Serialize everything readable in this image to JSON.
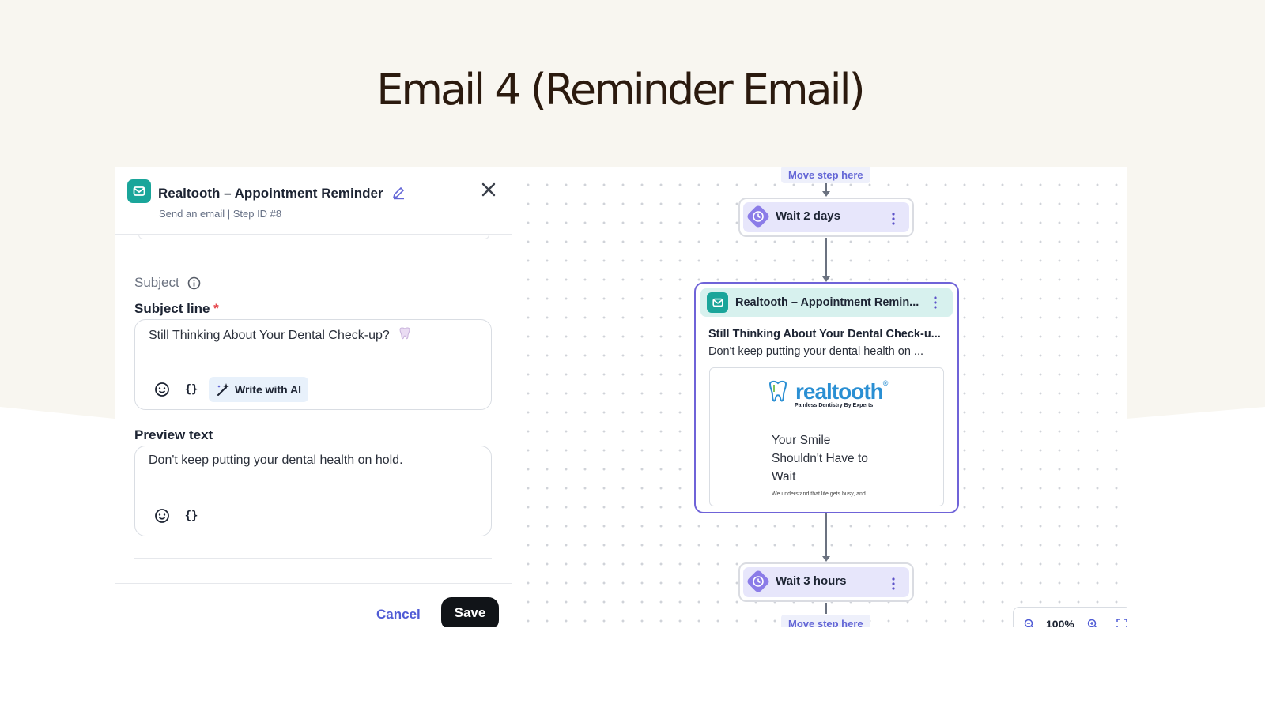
{
  "slide": {
    "title": "Email 4 (Reminder Email)"
  },
  "panel": {
    "title": "Realtooth – Appointment Reminder",
    "subtitle": "Send an email | Step ID #8",
    "section_label": "Subject",
    "subject_label": "Subject line",
    "required_mark": "*",
    "subject_value": "Still Thinking About Your Dental Check-up?",
    "write_ai_label": "Write with AI",
    "braces_label": "{}",
    "preview_label": "Preview text",
    "preview_value": "Don't keep putting your dental health on hold.",
    "cancel_label": "Cancel",
    "save_label": "Save"
  },
  "canvas": {
    "move_step_label": "Move step here",
    "wait_top": "Wait 2 days",
    "wait_bottom": "Wait 3 hours",
    "email_node": {
      "title": "Realtooth – Appointment Remin...",
      "subject": "Still Thinking About Your Dental Check-u...",
      "preview": "Don't keep putting your dental health on ...",
      "logo_text": "realtooth",
      "logo_registered": "®",
      "logo_tagline": "Painless Dentistry By Experts",
      "headline": "Your Smile Shouldn't Have to Wait",
      "body_snippet": "We understand that life gets busy, and"
    },
    "zoom_value": "100%"
  },
  "colors": {
    "accent": "#6f63d8",
    "teal": "#1aa59a",
    "save_bg": "#111418",
    "page_bg": "#f8f6f0"
  }
}
